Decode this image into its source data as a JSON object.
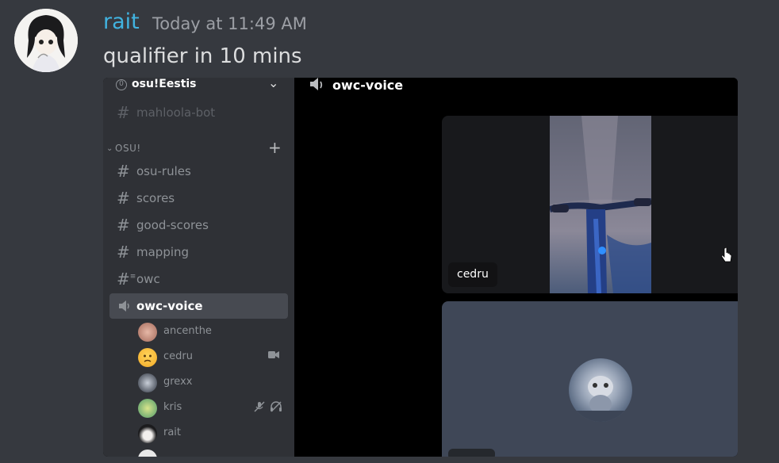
{
  "message": {
    "username": "rait",
    "timestamp": "Today at 11:49 AM",
    "text": "qualifier in 10 mins"
  },
  "sidebar": {
    "server_badge": "0",
    "server_name": "osu!Eestis",
    "channels_above": [
      {
        "name": "mahloola-bot"
      }
    ],
    "category": "OSU!",
    "channels": [
      {
        "name": "osu-rules",
        "type": "text"
      },
      {
        "name": "scores",
        "type": "text"
      },
      {
        "name": "good-scores",
        "type": "text"
      },
      {
        "name": "mapping",
        "type": "text"
      },
      {
        "name": "owc",
        "type": "text-rules"
      },
      {
        "name": "owc-voice",
        "type": "voice",
        "active": true
      }
    ],
    "voice_users": [
      {
        "name": "ancenthe"
      },
      {
        "name": "cedru",
        "camera": true
      },
      {
        "name": "grexx"
      },
      {
        "name": "kris",
        "muted": true,
        "deafened": true
      },
      {
        "name": "rait"
      }
    ]
  },
  "main": {
    "channel_title": "owc-voice",
    "tiles": [
      {
        "user": "cedru",
        "type": "video"
      },
      {
        "user": "",
        "type": "avatar"
      }
    ]
  },
  "colors": {
    "username": "#41b3e0",
    "background": "#36393f",
    "sidebar": "#2f3136",
    "active_channel": "#474a51"
  }
}
